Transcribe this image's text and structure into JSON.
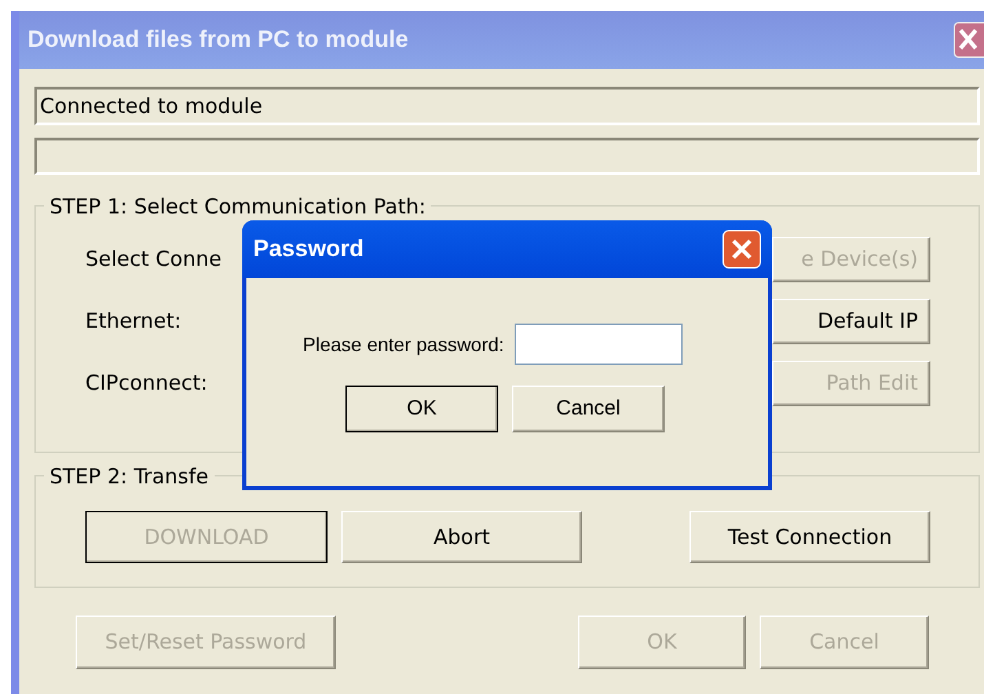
{
  "window": {
    "title": "Download files from PC to module"
  },
  "status_lines": [
    "Connected to module"
  ],
  "step1": {
    "title": "STEP 1: Select Communication Path:",
    "rows": [
      {
        "label": "Select Conne",
        "button": "e Device(s)",
        "disabled": true
      },
      {
        "label": "Ethernet:",
        "button": "Default IP",
        "disabled": false
      },
      {
        "label": "CIPconnect:",
        "button": "Path Edit",
        "disabled": true
      }
    ]
  },
  "step2": {
    "title": "STEP 2: Transfe",
    "buttons": [
      {
        "label": "DOWNLOAD",
        "disabled": true,
        "focused": true
      },
      {
        "label": "Abort",
        "disabled": false,
        "focused": false
      },
      {
        "label": "Test Connection",
        "disabled": false,
        "focused": false
      }
    ]
  },
  "footer_buttons": [
    {
      "label": "Set/Reset Password",
      "disabled": true
    },
    {
      "label": "OK",
      "disabled": true
    },
    {
      "label": "Cancel",
      "disabled": true
    }
  ],
  "password_dialog": {
    "title": "Password",
    "prompt": "Please enter password:",
    "buttons": [
      {
        "label": "OK",
        "focused": true
      },
      {
        "label": "Cancel",
        "focused": false
      }
    ]
  }
}
